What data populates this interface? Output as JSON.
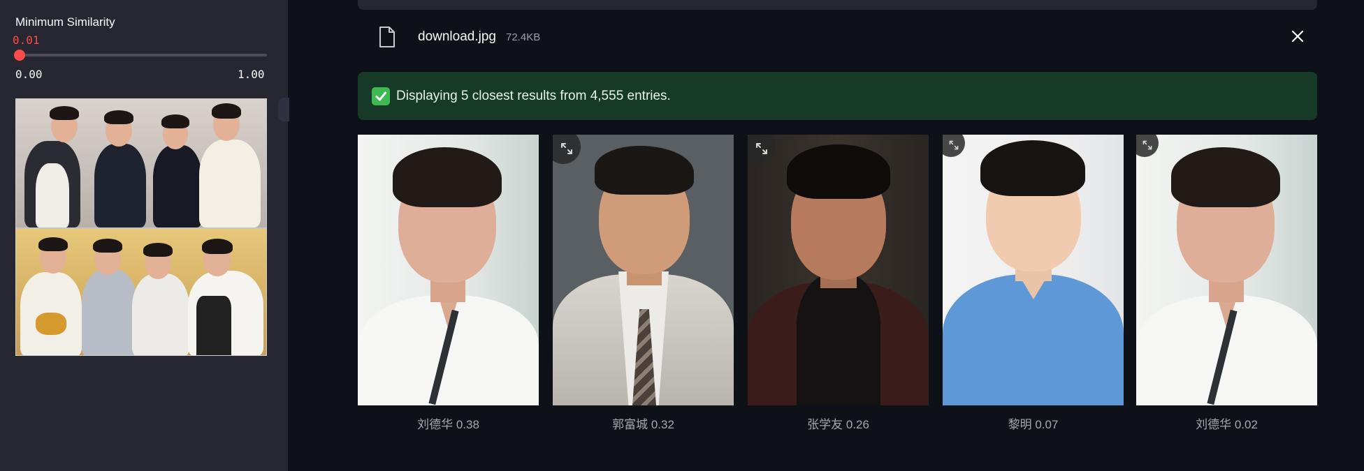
{
  "sidebar": {
    "slider": {
      "label": "Minimum Similarity",
      "value": "0.01",
      "value_fraction": 0.01,
      "min": "0.00",
      "max": "1.00"
    },
    "query_image_icon": "query-photo"
  },
  "uploader": {
    "file_icon": "file-icon",
    "file_name": "download.jpg",
    "file_size": "72.4KB",
    "close_icon": "close-icon"
  },
  "status": {
    "icon": "check-mark-icon",
    "message": "Displaying 5 closest results from 4,555 entries."
  },
  "results": [
    {
      "caption": "刘德华 0.38"
    },
    {
      "caption": "郭富城 0.32"
    },
    {
      "caption": "张学友 0.26"
    },
    {
      "caption": "黎明 0.07"
    },
    {
      "caption": "刘德华 0.02"
    }
  ],
  "colors": {
    "accent": "#ff4b4b",
    "background": "#0e1117",
    "sidebar": "#262730",
    "success_bg": "#173928",
    "success_check": "#3dbb52"
  }
}
